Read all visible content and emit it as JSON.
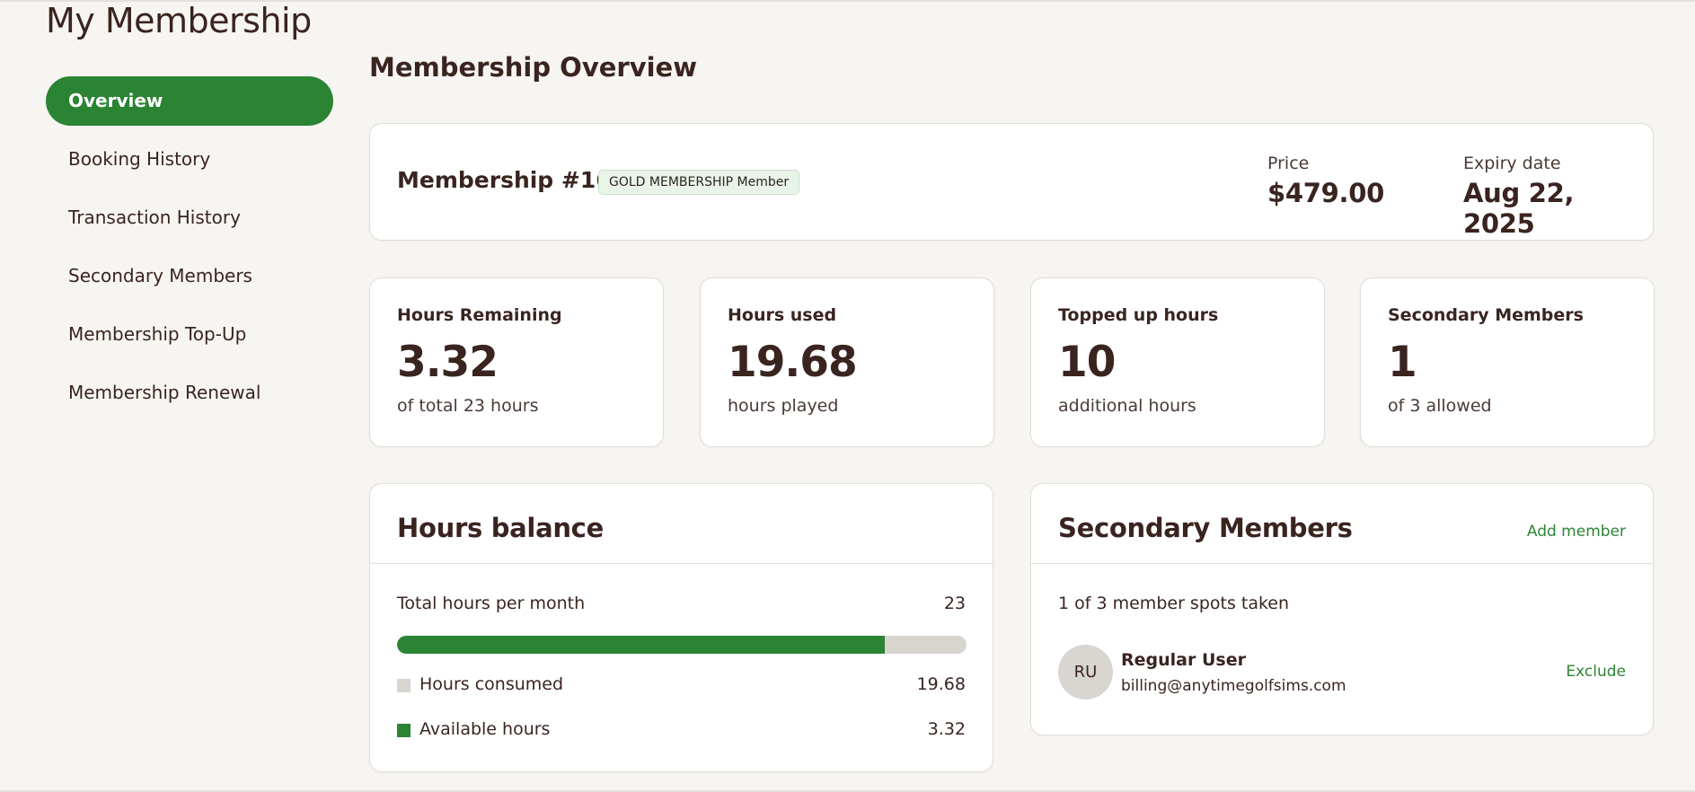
{
  "page": {
    "title": "My Membership"
  },
  "sidebar": {
    "items": [
      {
        "label": "Overview",
        "active": true
      },
      {
        "label": "Booking History"
      },
      {
        "label": "Transaction History"
      },
      {
        "label": "Secondary Members"
      },
      {
        "label": "Membership Top-Up"
      },
      {
        "label": "Membership Renewal"
      }
    ]
  },
  "overview": {
    "title": "Membership Overview",
    "membership_title": "Membership #169",
    "badge": "GOLD MEMBERSHIP Member",
    "price_label": "Price",
    "price_value": "$479.00",
    "expiry_label": "Expiry date",
    "expiry_value": "Aug 22, 2025"
  },
  "stats": [
    {
      "title": "Hours Remaining",
      "value": "3.32",
      "sub": "of total 23 hours"
    },
    {
      "title": "Hours used",
      "value": "19.68",
      "sub": "hours played"
    },
    {
      "title": "Topped up hours",
      "value": "10",
      "sub": "additional hours"
    },
    {
      "title": "Secondary Members",
      "value": "1",
      "sub": "of 3 allowed"
    }
  ],
  "hours_balance": {
    "title": "Hours balance",
    "total_label": "Total hours per month",
    "total_value": "23",
    "progress_fraction": 0.856,
    "consumed_label": "Hours consumed",
    "consumed_value": "19.68",
    "available_label": "Available hours",
    "available_value": "3.32"
  },
  "secondary_members": {
    "title": "Secondary Members",
    "add_label": "Add member",
    "spots_text": "1 of 3 member spots taken",
    "members": [
      {
        "initials": "RU",
        "name": "Regular User",
        "email": "billing@anytimegolfsims.com",
        "action": "Exclude"
      }
    ]
  },
  "colors": {
    "accent": "#2b8434",
    "text": "#3a2420",
    "background": "#f7f5f1",
    "bar_track": "#d8d5d1"
  }
}
